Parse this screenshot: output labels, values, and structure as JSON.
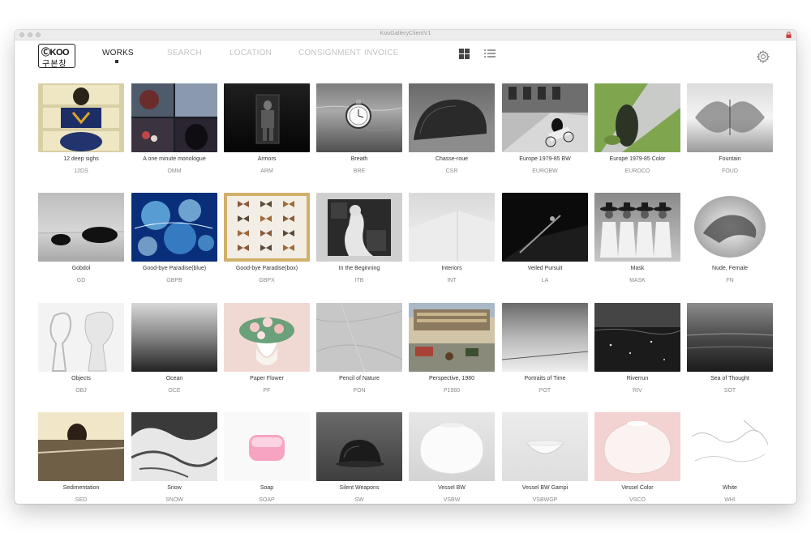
{
  "window": {
    "title": "KooGalleryClientV1"
  },
  "logo": {
    "line1": "ⒸKOO",
    "line2": "구본창"
  },
  "nav": [
    {
      "label": "WORKS",
      "active": true
    },
    {
      "label": "SEARCH",
      "active": false
    },
    {
      "label": "LOCATION",
      "active": false
    },
    {
      "label": "CONSIGNMENT",
      "active": false
    },
    {
      "label": "INVOICE",
      "active": false
    }
  ],
  "toolbar": {
    "grid_view_icon": "grid-view-icon",
    "list_view_icon": "list-view-icon",
    "settings_icon": "gear-icon"
  },
  "works": [
    {
      "title": "12 deep sighs",
      "code": "12DS"
    },
    {
      "title": "A one minute monologue",
      "code": "OMM"
    },
    {
      "title": "Armors",
      "code": "ARM"
    },
    {
      "title": "Breath",
      "code": "BRE"
    },
    {
      "title": "Chasse-roue",
      "code": "CSR"
    },
    {
      "title": "Europe 1979-85 BW",
      "code": "EUROBW"
    },
    {
      "title": "Europe 1979-85 Color",
      "code": "EUROCO"
    },
    {
      "title": "Fountain",
      "code": "FOUD"
    },
    {
      "title": "Gobdol",
      "code": "GD"
    },
    {
      "title": "Good-bye Paradise(blue)",
      "code": "GBPB"
    },
    {
      "title": "Good-bye Paradise(box)",
      "code": "GBPX"
    },
    {
      "title": "In the Beginning",
      "code": "ITB"
    },
    {
      "title": "Interiors",
      "code": "INT"
    },
    {
      "title": "Veiled Pursuit",
      "code": "LA"
    },
    {
      "title": "Mask",
      "code": "MASK"
    },
    {
      "title": "Nude, Female",
      "code": "FN"
    },
    {
      "title": "Objects",
      "code": "OBJ"
    },
    {
      "title": "Ocean",
      "code": "OCE"
    },
    {
      "title": "Paper Flower",
      "code": "PF"
    },
    {
      "title": "Pencil of Nature",
      "code": "PON"
    },
    {
      "title": "Perspective, 1980",
      "code": "P1980"
    },
    {
      "title": "Portraits of Time",
      "code": "POT"
    },
    {
      "title": "Riverrun",
      "code": "RIV"
    },
    {
      "title": "Sea of Thought",
      "code": "SOT"
    },
    {
      "title": "Sedimentation",
      "code": "SED"
    },
    {
      "title": "Snow",
      "code": "SNOW"
    },
    {
      "title": "Soap",
      "code": "SOAP"
    },
    {
      "title": "Silent Weapons",
      "code": "SW"
    },
    {
      "title": "Vessel BW",
      "code": "VSBW"
    },
    {
      "title": "Vessel BW Gampi",
      "code": "VSBWGP"
    },
    {
      "title": "Vessel Color",
      "code": "VSCO"
    },
    {
      "title": "White",
      "code": "WHI"
    }
  ]
}
